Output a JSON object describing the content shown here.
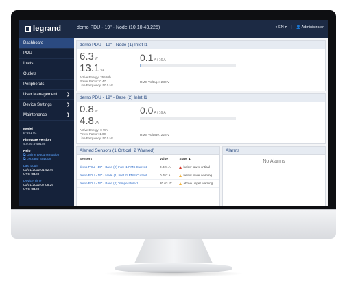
{
  "header": {
    "brand": "legrand",
    "title": "demo PDU - 19\" - Node",
    "ip": "(10.10.43.225)",
    "language": "EN",
    "user": "Administrator"
  },
  "sidebar": {
    "items": [
      {
        "label": "Dashboard",
        "active": true,
        "chevron": false
      },
      {
        "label": "PDU",
        "active": false,
        "chevron": false
      },
      {
        "label": "Inlets",
        "active": false,
        "chevron": false
      },
      {
        "label": "Outlets",
        "active": false,
        "chevron": false
      },
      {
        "label": "Peripherals",
        "active": false,
        "chevron": false
      },
      {
        "label": "User Management",
        "active": false,
        "chevron": true
      },
      {
        "label": "Device Settings",
        "active": false,
        "chevron": true
      },
      {
        "label": "Maintenance",
        "active": false,
        "chevron": true
      }
    ],
    "model_label": "Model",
    "model_value": "E-461 01",
    "firmware_label": "Firmware Version",
    "firmware_value": "4.0.30.5-49156",
    "help_label": "Help",
    "help_links": [
      "Online Documentation",
      "Legrand Support"
    ],
    "last_login_label": "Last Login",
    "last_login_value": "01/01/2012 01:42:46 UTC+0100",
    "device_time_label": "Device Time",
    "device_time_value": "01/01/2012 07:08:26 UTC+0100"
  },
  "inlets": [
    {
      "title": "demo PDU - 19\" - Node (1) Inlet I1",
      "power_w": "6.3",
      "power_w_unit": "W",
      "power_va": "13.1",
      "power_va_unit": "VA",
      "active_energy": "Active Energy: 255 Wh",
      "power_factor": "Power Factor: 0.47",
      "line_frequency": "Line Frequency: 50.0 Hz",
      "current": "0.1",
      "current_unit": "A / 16 A",
      "current_fraction": 0.006,
      "rms_voltage": "RMS Voltage: 230 V"
    },
    {
      "title": "demo PDU - 19\" - Base (2) Inlet I1",
      "power_w": "0.8",
      "power_w_unit": "W",
      "power_va": "4.8",
      "power_va_unit": "VA",
      "active_energy": "Active Energy: 0 Wh",
      "power_factor": "Power Factor: 1.00",
      "line_frequency": "Line Frequency: 50.0 Hz",
      "current": "0.0",
      "current_unit": "A / 16 A",
      "current_fraction": 0.0,
      "rms_voltage": "RMS Voltage: 228 V"
    }
  ],
  "sensors": {
    "title": "Alerted Sensors (1 Critical, 2 Warned)",
    "columns": [
      "Sensors",
      "Value",
      "State ▲"
    ],
    "rows": [
      {
        "name": "demo PDU - 19\" - Base (2) Inlet I1 RMS Current",
        "value": "0.021 A",
        "state": "below lower critical",
        "level": "critical"
      },
      {
        "name": "demo PDU - 19\" - Node (1) Inlet I1 RMS Current",
        "value": "0.057 A",
        "state": "below lower warning",
        "level": "warning"
      },
      {
        "name": "demo PDU - 19\" - Base (2) Temperature 1",
        "value": "20.63 °C",
        "state": "above upper warning",
        "level": "warning"
      }
    ]
  },
  "alarms": {
    "title": "Alarms",
    "empty_text": "No Alarms"
  },
  "colors": {
    "topbar": "#1c2a44",
    "sidebar": "#15223a",
    "active_nav": "#2b4a80",
    "critical": "#d93a2b",
    "warning": "#f3b23a"
  }
}
